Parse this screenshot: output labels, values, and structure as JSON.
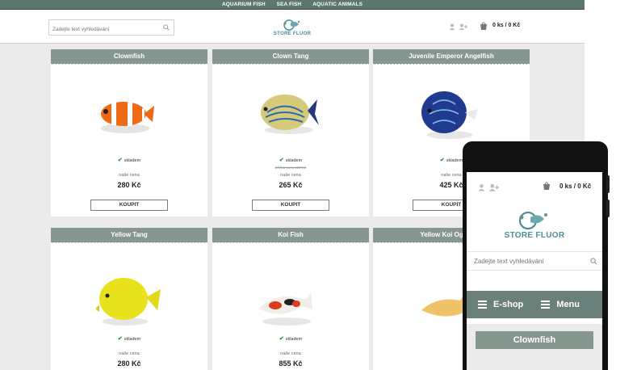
{
  "topnav": {
    "items": [
      "AQUARIUM FISH",
      "SEA FISH",
      "AQUATIC ANIMALS"
    ]
  },
  "header": {
    "search_placeholder": "Zadejte text vyhledávání",
    "logo_text": "STORE FLUOR",
    "cart_text": "0 ks / 0 Kč",
    "user_icons": [
      "user-icon",
      "add-user-icon"
    ]
  },
  "products": [
    {
      "name": "Clownfish",
      "stock": "skladem",
      "old_price": "",
      "price_label": "naše cena",
      "price": "280 Kč",
      "buy": "KOUPIT"
    },
    {
      "name": "Clown Tang",
      "stock": "skladem",
      "old_price": "běžná cena 390 Kč",
      "price_label": "naše cena",
      "price": "265 Kč",
      "buy": "KOUPIT"
    },
    {
      "name": "Juvenile Emperor Angelfish",
      "stock": "skladem",
      "old_price": "",
      "price_label": "naše cena",
      "price": "425 Kč",
      "buy": "KOUPIT"
    },
    {
      "name": "Yellow Tang",
      "stock": "skladem",
      "old_price": "",
      "price_label": "naše cena",
      "price": "280 Kč",
      "buy": ""
    },
    {
      "name": "Koi Fish",
      "stock": "skladem",
      "old_price": "",
      "price_label": "naše cena",
      "price": "855 Kč",
      "buy": ""
    },
    {
      "name": "Yellow Koi Og",
      "stock": "",
      "old_price": "",
      "price_label": "",
      "price": "",
      "buy": ""
    }
  ],
  "mobile": {
    "cart_text": "0 ks / 0 Kč",
    "logo_text": "STORE FLUOR",
    "search_placeholder": "Zadejte text vyhledávání",
    "nav": [
      "E-shop",
      "Menu"
    ],
    "first_card_title": "Clownfish"
  },
  "colors": {
    "accent": "#5c7670",
    "card_title": "#86978f",
    "logo": "#4a8f99",
    "check": "#2e9a3a"
  }
}
